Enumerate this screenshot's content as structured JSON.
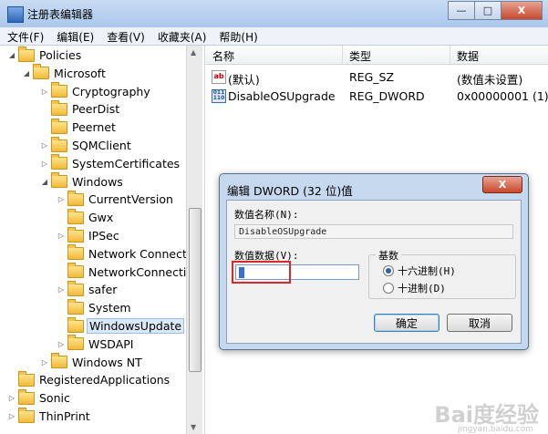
{
  "window": {
    "title": "注册表编辑器",
    "minimize": "—",
    "maximize": "□",
    "close": "X"
  },
  "menu": [
    "文件(F)",
    "编辑(E)",
    "查看(V)",
    "收藏夹(A)",
    "帮助(H)"
  ],
  "tree": [
    {
      "label": "Policies",
      "arrow": "◢"
    },
    {
      "label": "Microsoft",
      "arrow": "◢"
    },
    {
      "label": "Cryptography",
      "arrow": "▷"
    },
    {
      "label": "PeerDist",
      "arrow": ""
    },
    {
      "label": "Peernet",
      "arrow": ""
    },
    {
      "label": "SQMClient",
      "arrow": "▷"
    },
    {
      "label": "SystemCertificates",
      "arrow": "▷"
    },
    {
      "label": "Windows",
      "arrow": "◢"
    },
    {
      "label": "CurrentVersion",
      "arrow": "▷"
    },
    {
      "label": "Gwx",
      "arrow": ""
    },
    {
      "label": "IPSec",
      "arrow": "▷"
    },
    {
      "label": "Network Connecti",
      "arrow": ""
    },
    {
      "label": "NetworkConnectiv",
      "arrow": ""
    },
    {
      "label": "safer",
      "arrow": "▷"
    },
    {
      "label": "System",
      "arrow": ""
    },
    {
      "label": "WindowsUpdate",
      "arrow": "",
      "selected": true
    },
    {
      "label": "WSDAPI",
      "arrow": "▷"
    },
    {
      "label": "Windows NT",
      "arrow": "▷"
    },
    {
      "label": "RegisteredApplications",
      "arrow": ""
    },
    {
      "label": "Sonic",
      "arrow": "▷"
    },
    {
      "label": "ThinPrint",
      "arrow": "▷"
    }
  ],
  "list": {
    "headers": [
      "名称",
      "类型",
      "数据"
    ],
    "rows": [
      {
        "icon": "ab",
        "name": "(默认)",
        "type": "REG_SZ",
        "data": "(数值未设置)"
      },
      {
        "icon": "bin",
        "name": "DisableOSUpgrade",
        "type": "REG_DWORD",
        "data": "0x00000001 (1)"
      }
    ]
  },
  "dialog": {
    "title": "编辑 DWORD (32 位)值",
    "close": "X",
    "value_name_label": "数值名称(N):",
    "value_name": "DisableOSUpgrade",
    "value_data_label": "数值数据(V):",
    "value_data": "1",
    "base_label": "基数",
    "hex_label": "十六进制(H)",
    "dec_label": "十进制(D)",
    "ok": "确定",
    "cancel": "取消"
  },
  "icons": {
    "ab": "string-value-icon",
    "bin": "binary-value-icon"
  },
  "colors": {
    "highlight": "#d8282a",
    "selection": "#dbe8f9"
  }
}
